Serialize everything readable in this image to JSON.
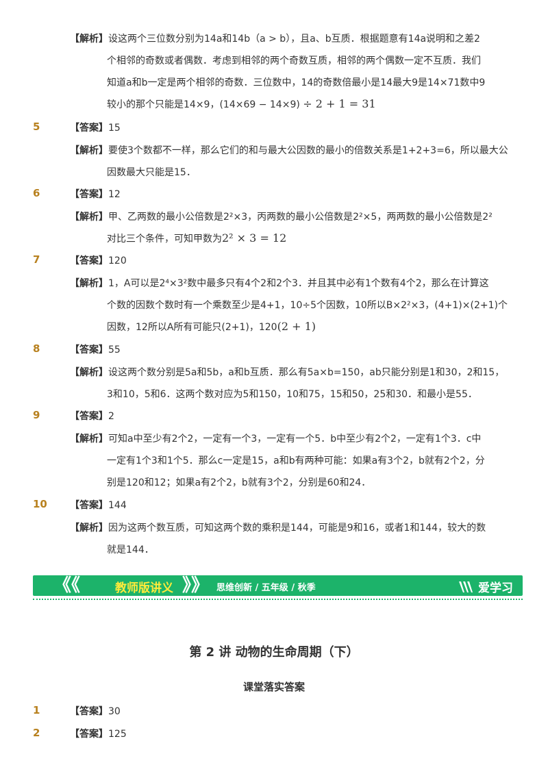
{
  "sol_tag": "【解析】",
  "ans_tag": "【答案】",
  "q4": {
    "lines": [
      "设这两个三位数分别为14a和14b（a > b），且a、b互质．根据题意有14a说明和之差2",
      "个相邻的奇数或者偶数．考虑到相邻的两个奇数互质，相邻的两个偶数一定不互质．我们",
      "知道a和b一定是两个相邻的奇数．三位数中，14的奇数倍最小是14最大9是14×71数中9",
      "较小的那个只能是14×9，(14×69 − 14×9)"
    ],
    "formula": "÷ 2 + 1 = 31"
  },
  "q5": {
    "num": "5",
    "answer": "15",
    "lines": [
      "要使3个数都不一样，那么它们的和与最大公因数的最小的倍数关系是1+2+3=6，所以最大公",
      "因数最大只能是15．"
    ]
  },
  "q6": {
    "num": "6",
    "answer": "12",
    "lines": [
      "甲、乙两数的最小公倍数是2²×3，丙两数的最小公倍数是2²×5，两两数的最小公倍数是2²",
      "对比三个条件，可知甲数为"
    ],
    "formula": "2² × 3 = 12"
  },
  "q7": {
    "num": "7",
    "answer": "120",
    "lines": [
      "1，A可以是2⁴×3²数中最多只有4个2和2个3．并且其中必有1个数有4个2，那么在计算这",
      "个数的因数个数时有一个乘数至少是4+1，10÷5个因数，10所以B×2²×3，(4+1)×(2+1)个",
      "因数，12所以A所有可能只(2+1)，120"
    ],
    "formula": "(2 + 1)"
  },
  "q8": {
    "num": "8",
    "answer": "55",
    "lines": [
      "设这两个数分别是5a和5b，a和b互质．那么有5a×b=150，ab只能分别是1和30，2和15，",
      "3和10，5和6．这两个数对应为5和150，10和75，15和50，25和30．和最小是55．"
    ]
  },
  "q9": {
    "num": "9",
    "answer": "2",
    "lines": [
      "可知a中至少有2个2，一定有一个3，一定有一个5．b中至少有2个2，一定有1个3．c中",
      "一定有1个3和1个5．那么c一定是15，a和b有两种可能：如果a有3个2，b就有2个2，分",
      "别是120和12；如果a有2个2，b就有3个2，分别是60和24．"
    ]
  },
  "q10": {
    "num": "10",
    "answer": "144",
    "lines": [
      "因为这两个数互质，可知这两个数的乘积是144，可能是9和16，或者1和144，较大的数",
      "就是144．"
    ]
  },
  "banner": {
    "title": "教师版讲义",
    "subtitle": "思维创新 / 五年级 / 秋季",
    "brand": "爱学习",
    "accent": "#1cb36a",
    "title_color": "#ffeb3b"
  },
  "lecture_title": "第 2 讲  动物的生命周期（下）",
  "section_title": "课堂落实答案",
  "p1": {
    "num": "1",
    "answer": "30"
  },
  "p2": {
    "num": "2",
    "answer": "125"
  }
}
